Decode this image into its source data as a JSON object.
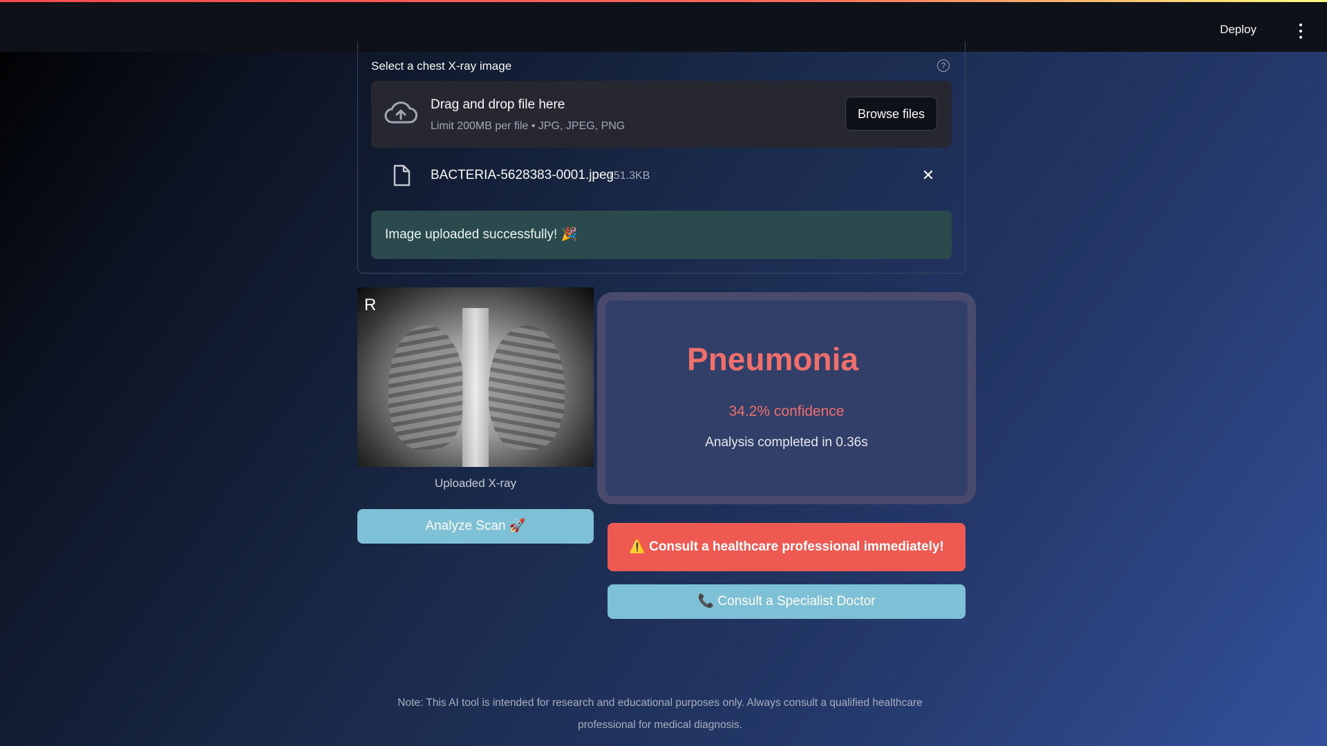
{
  "header": {
    "deploy_label": "Deploy"
  },
  "uploader": {
    "label": "Select a chest X-ray image",
    "help_symbol": "?",
    "drop_title": "Drag and drop file here",
    "drop_subtitle": "Limit 200MB per file • JPG, JPEG, PNG",
    "browse_label": "Browse files",
    "file_name": "BACTERIA-5628383-0001.jpeg",
    "file_size": "151.3KB",
    "success_message": "Image uploaded successfully! 🎉"
  },
  "xray": {
    "marker": "R",
    "caption": "Uploaded X-ray"
  },
  "analyze_label": "Analyze Scan 🚀",
  "result": {
    "diagnosis": "Pneumonia",
    "confidence": "34.2% confidence",
    "timing": "Analysis completed in 0.36s"
  },
  "warning": "⚠️ Consult a healthcare professional immediately!",
  "consult_label": "📞 Consult a Specialist Doctor",
  "footer_note": "Note: This AI tool is intended for research and educational purposes only. Always consult a qualified healthcare professional for medical diagnosis.",
  "colors": {
    "alert_red": "#ee5a52",
    "diagnosis_red": "#ee6f6b",
    "button_blue": "#7ec1d6",
    "success_green": "#2a4a4e"
  }
}
